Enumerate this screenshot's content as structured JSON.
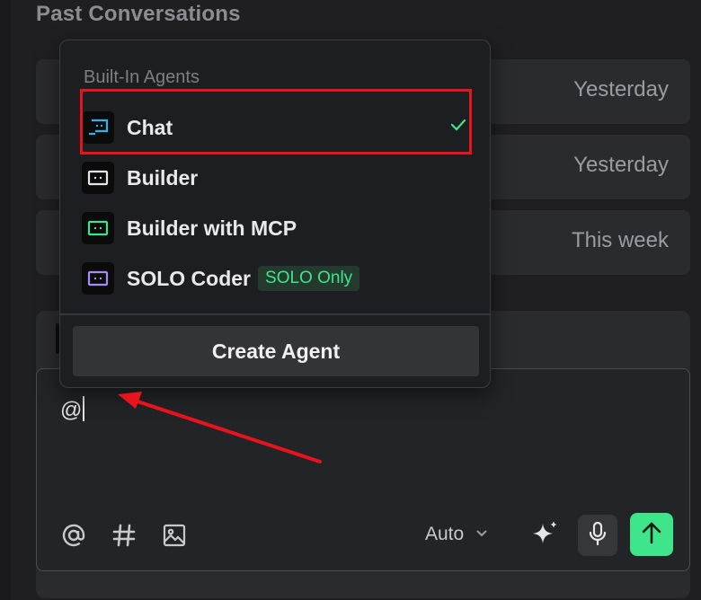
{
  "past_conversations": {
    "title": "Past Conversations",
    "items": [
      {
        "time": "Yesterday"
      },
      {
        "time": "Yesterday"
      },
      {
        "time": "This week"
      }
    ]
  },
  "agent_menu": {
    "section_heading": "Built-In Agents",
    "agents": [
      {
        "label": "Chat",
        "icon": "chat-agent-icon",
        "icon_color": "#2bb6e6",
        "selected": true
      },
      {
        "label": "Builder",
        "icon": "builder-agent-icon",
        "icon_color": "#e6e6e8",
        "selected": false
      },
      {
        "label": "Builder with MCP",
        "icon": "builder-mcp-agent-icon",
        "icon_color": "#3ee58b",
        "selected": false
      },
      {
        "label": "SOLO Coder",
        "icon": "solo-coder-agent-icon",
        "icon_color": "#a58bf5",
        "selected": false,
        "badge": "SOLO Only"
      }
    ],
    "create_button": "Create Agent"
  },
  "composer": {
    "input_value": "@",
    "model_select": "Auto",
    "tools": [
      "at-mention-icon",
      "hashtag-icon",
      "image-icon"
    ]
  },
  "colors": {
    "accent_green": "#3ee58b",
    "annotation_red": "#e8141c"
  }
}
